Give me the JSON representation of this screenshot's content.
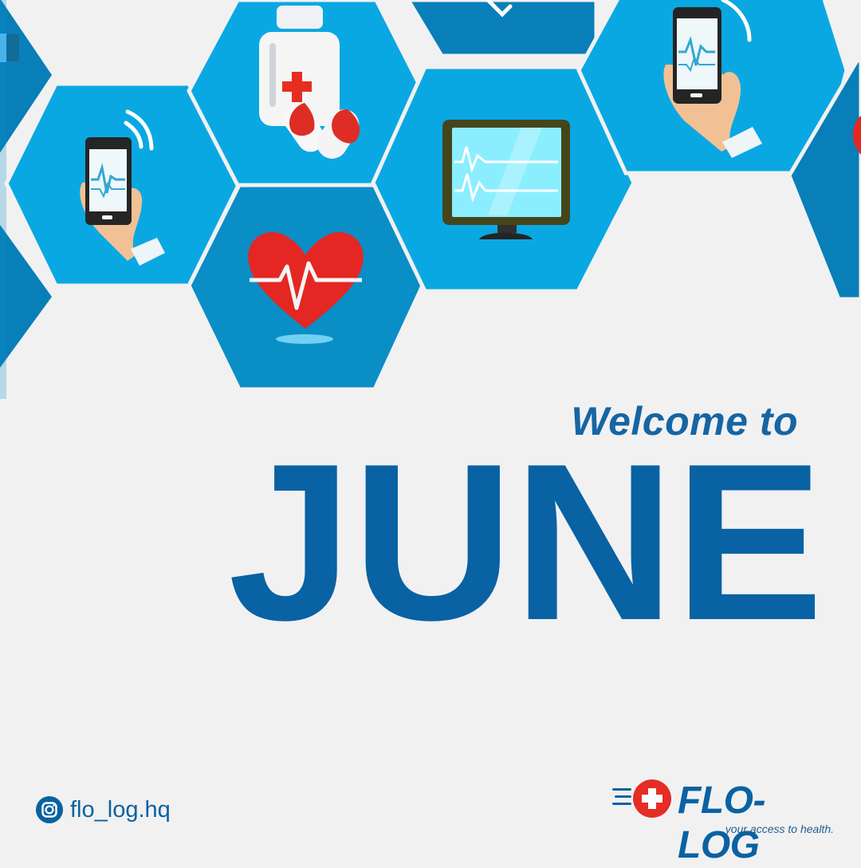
{
  "artwork": {
    "icons": [
      "partial-device-icon",
      "phone-in-hand-icon",
      "medicine-bottle-icon",
      "capsule-icon",
      "heart-rate-icon",
      "computer-monitor-icon",
      "wifi-signal-icon"
    ]
  },
  "hero": {
    "welcome_text": "Welcome to",
    "month_text": "JUNE"
  },
  "social": {
    "platform_icon": "instagram-icon",
    "handle": "flo_log.hq"
  },
  "brand": {
    "name": "FLO-LOG",
    "tagline": "...your access to health."
  },
  "colors": {
    "background": "#f1f1f2",
    "primary_blue": "#0862a3",
    "light_blue": "#0aa8e2",
    "medium_blue": "#0b91c8",
    "red": "#e52c25"
  }
}
